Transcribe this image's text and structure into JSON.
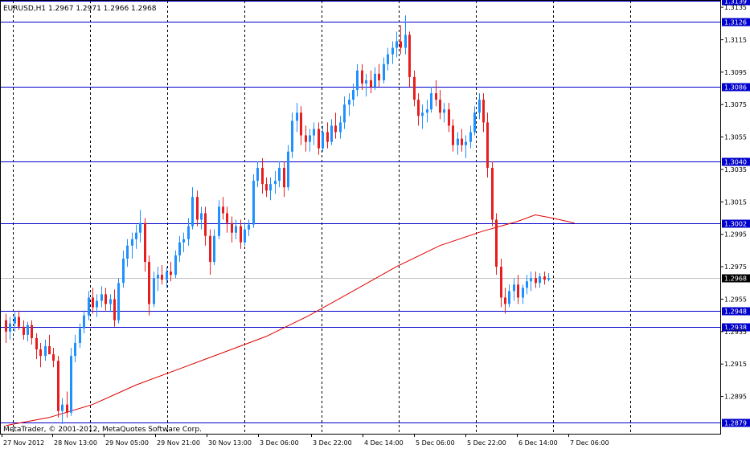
{
  "header": {
    "symbol_text": "EURUSD,H1  1.2967 1.2971 1.2966 1.2968"
  },
  "footer": {
    "copyright": "MetaTrader, © 2001-2012, MetaQuotes Software Corp."
  },
  "colors": {
    "background": "#ffffff",
    "frame": "#000000",
    "grid": "#000000",
    "bull": "#1e90ff",
    "bear": "#e81d1d",
    "moving_average": "#e00000",
    "levels": "#0000cc",
    "current_price_line": "#c0c0c0",
    "current_price_tag": "#000000"
  },
  "chart_data": {
    "type": "candlestick",
    "ylim": [
      1.2872,
      1.3139
    ],
    "y_ticks": [
      "1.3135",
      "1.3115",
      "1.3095",
      "1.3075",
      "1.3055",
      "1.3035",
      "1.3015",
      "1.2995",
      "1.2975",
      "1.2955",
      "1.2935",
      "1.2915",
      "1.2895"
    ],
    "x_ticks": [
      "27 Nov 2012",
      "28 Nov 13:00",
      "29 Nov 05:00",
      "29 Nov 21:00",
      "30 Nov 13:00",
      "3 Dec 06:00",
      "3 Dec 22:00",
      "4 Dec 14:00",
      "5 Dec 06:00",
      "5 Dec 22:00",
      "6 Dec 14:00",
      "7 Dec 06:00"
    ],
    "levels": [
      "1.3139",
      "1.3126",
      "1.3086",
      "1.3040",
      "1.3002",
      "1.2948",
      "1.2938",
      "1.2879"
    ],
    "current_price": "1.2968",
    "candles": [
      [
        1.2942,
        1.2946,
        1.2928,
        1.2935
      ],
      [
        1.2935,
        1.2944,
        1.293,
        1.294
      ],
      [
        1.294,
        1.2947,
        1.2935,
        1.2944
      ],
      [
        1.2944,
        1.2948,
        1.2936,
        1.2938
      ],
      [
        1.2938,
        1.2942,
        1.293,
        1.2933
      ],
      [
        1.2933,
        1.2941,
        1.2929,
        1.2939
      ],
      [
        1.2939,
        1.2942,
        1.2927,
        1.2931
      ],
      [
        1.2931,
        1.2934,
        1.2918,
        1.2924
      ],
      [
        1.2924,
        1.2928,
        1.2913,
        1.292
      ],
      [
        1.292,
        1.293,
        1.2917,
        1.2926
      ],
      [
        1.2926,
        1.2933,
        1.2922,
        1.2921
      ],
      [
        1.2921,
        1.2925,
        1.2913,
        1.2917
      ],
      [
        1.2917,
        1.292,
        1.2882,
        1.2886
      ],
      [
        1.2886,
        1.2894,
        1.2878,
        1.289
      ],
      [
        1.289,
        1.2898,
        1.2882,
        1.2885
      ],
      [
        1.2885,
        1.2925,
        1.2883,
        1.292
      ],
      [
        1.292,
        1.2933,
        1.2916,
        1.2928
      ],
      [
        1.2928,
        1.294,
        1.2925,
        1.2937
      ],
      [
        1.2937,
        1.2948,
        1.2934,
        1.2945
      ],
      [
        1.2945,
        1.296,
        1.2942,
        1.2956
      ],
      [
        1.2956,
        1.2962,
        1.2946,
        1.295
      ],
      [
        1.295,
        1.2958,
        1.2944,
        1.2954
      ],
      [
        1.2954,
        1.2963,
        1.295,
        1.2958
      ],
      [
        1.2958,
        1.2962,
        1.2948,
        1.2952
      ],
      [
        1.2952,
        1.2958,
        1.2947,
        1.2955
      ],
      [
        1.2955,
        1.2961,
        1.2938,
        1.2942
      ],
      [
        1.2942,
        1.2968,
        1.294,
        1.2965
      ],
      [
        1.2965,
        1.2985,
        1.2962,
        1.298
      ],
      [
        1.298,
        1.2992,
        1.2975,
        1.2988
      ],
      [
        1.2988,
        1.2996,
        1.298,
        1.2992
      ],
      [
        1.2992,
        1.3001,
        1.2986,
        1.2996
      ],
      [
        1.2996,
        1.301,
        1.299,
        1.3002
      ],
      [
        1.3002,
        1.3005,
        1.2972,
        1.2978
      ],
      [
        1.2978,
        1.2982,
        1.2945,
        1.2952
      ],
      [
        1.2952,
        1.2972,
        1.295,
        1.2968
      ],
      [
        1.2968,
        1.2975,
        1.296,
        1.297
      ],
      [
        1.297,
        1.2976,
        1.2964,
        1.2967
      ],
      [
        1.2967,
        1.2975,
        1.2962,
        1.2972
      ],
      [
        1.2972,
        1.2978,
        1.2966,
        1.297
      ],
      [
        1.297,
        1.2985,
        1.2968,
        1.2982
      ],
      [
        1.2982,
        1.2994,
        1.2978,
        1.299
      ],
      [
        1.299,
        1.2996,
        1.2984,
        1.2992
      ],
      [
        1.2992,
        1.3005,
        1.2988,
        1.3
      ],
      [
        1.3,
        1.3024,
        1.2998,
        1.3018
      ],
      [
        1.3018,
        1.3022,
        1.3,
        1.3004
      ],
      [
        1.3004,
        1.3012,
        1.2998,
        1.3008
      ],
      [
        1.3008,
        1.3012,
        1.2988,
        1.2994
      ],
      [
        1.2994,
        1.2998,
        1.297,
        1.2978
      ],
      [
        1.2978,
        1.2998,
        1.2976,
        1.2994
      ],
      [
        1.2994,
        1.3016,
        1.2992,
        1.3012
      ],
      [
        1.3012,
        1.3018,
        1.3004,
        1.3008
      ],
      [
        1.3008,
        1.3012,
        1.2996,
        1.3002
      ],
      [
        1.3002,
        1.3006,
        1.299,
        1.2996
      ],
      [
        1.2996,
        1.3004,
        1.2992,
        1.3
      ],
      [
        1.3,
        1.3004,
        1.2986,
        1.299
      ],
      [
        1.299,
        1.3002,
        1.2988,
        1.2998
      ],
      [
        1.2998,
        1.3004,
        1.2994,
        1.3001
      ],
      [
        1.3001,
        1.3032,
        1.2999,
        1.3028
      ],
      [
        1.3028,
        1.304,
        1.3024,
        1.3036
      ],
      [
        1.3036,
        1.3042,
        1.302,
        1.3026
      ],
      [
        1.3026,
        1.303,
        1.3018,
        1.3022
      ],
      [
        1.3022,
        1.303,
        1.3016,
        1.3026
      ],
      [
        1.3026,
        1.3034,
        1.302,
        1.3028
      ],
      [
        1.3028,
        1.304,
        1.3024,
        1.3036
      ],
      [
        1.3036,
        1.304,
        1.3018,
        1.3024
      ],
      [
        1.3024,
        1.305,
        1.3022,
        1.3046
      ],
      [
        1.3046,
        1.307,
        1.3042,
        1.3065
      ],
      [
        1.3065,
        1.3076,
        1.3058,
        1.307
      ],
      [
        1.307,
        1.3074,
        1.305,
        1.3056
      ],
      [
        1.3056,
        1.3062,
        1.3046,
        1.3052
      ],
      [
        1.3052,
        1.306,
        1.3046,
        1.3056
      ],
      [
        1.3056,
        1.3064,
        1.305,
        1.306
      ],
      [
        1.306,
        1.3064,
        1.3044,
        1.3048
      ],
      [
        1.3048,
        1.3062,
        1.3046,
        1.3058
      ],
      [
        1.3058,
        1.3064,
        1.3048,
        1.3052
      ],
      [
        1.3052,
        1.3066,
        1.305,
        1.3062
      ],
      [
        1.3062,
        1.307,
        1.3054,
        1.3058
      ],
      [
        1.3058,
        1.3068,
        1.3054,
        1.3064
      ],
      [
        1.3064,
        1.308,
        1.306,
        1.3075
      ],
      [
        1.3075,
        1.3082,
        1.3068,
        1.3078
      ],
      [
        1.3078,
        1.3088,
        1.3074,
        1.3084
      ],
      [
        1.3084,
        1.31,
        1.308,
        1.3096
      ],
      [
        1.3096,
        1.31,
        1.3084,
        1.3088
      ],
      [
        1.3088,
        1.3094,
        1.308,
        1.309
      ],
      [
        1.309,
        1.3096,
        1.3082,
        1.3086
      ],
      [
        1.3086,
        1.3098,
        1.3084,
        1.3094
      ],
      [
        1.3094,
        1.31,
        1.3086,
        1.309
      ],
      [
        1.309,
        1.3104,
        1.3088,
        1.31
      ],
      [
        1.31,
        1.311,
        1.3096,
        1.3106
      ],
      [
        1.3106,
        1.3114,
        1.31,
        1.311
      ],
      [
        1.311,
        1.312,
        1.3104,
        1.3114
      ],
      [
        1.3114,
        1.3124,
        1.3106,
        1.311
      ],
      [
        1.311,
        1.313,
        1.3106,
        1.3118
      ],
      [
        1.3118,
        1.312,
        1.3086,
        1.3092
      ],
      [
        1.3092,
        1.3096,
        1.3074,
        1.3078
      ],
      [
        1.3078,
        1.3082,
        1.3062,
        1.3068
      ],
      [
        1.3068,
        1.3075,
        1.306,
        1.307
      ],
      [
        1.307,
        1.3078,
        1.3064,
        1.3072
      ],
      [
        1.3072,
        1.3086,
        1.307,
        1.3082
      ],
      [
        1.3082,
        1.309,
        1.3074,
        1.3078
      ],
      [
        1.3078,
        1.3084,
        1.3066,
        1.307
      ],
      [
        1.307,
        1.3076,
        1.3064,
        1.3072
      ],
      [
        1.3072,
        1.3076,
        1.3058,
        1.3062
      ],
      [
        1.3062,
        1.3066,
        1.3046,
        1.305
      ],
      [
        1.305,
        1.3058,
        1.3044,
        1.3054
      ],
      [
        1.3054,
        1.306,
        1.3046,
        1.305
      ],
      [
        1.305,
        1.3056,
        1.3042,
        1.3052
      ],
      [
        1.3052,
        1.3062,
        1.3048,
        1.3058
      ],
      [
        1.3058,
        1.3074,
        1.3056,
        1.307
      ],
      [
        1.307,
        1.3082,
        1.3066,
        1.3078
      ],
      [
        1.3078,
        1.3082,
        1.3058,
        1.3064
      ],
      [
        1.3064,
        1.307,
        1.303,
        1.3036
      ],
      [
        1.3036,
        1.304,
        1.3,
        1.3004
      ],
      [
        1.3004,
        1.3008,
        1.297,
        1.2975
      ],
      [
        1.2975,
        1.298,
        1.295,
        1.2956
      ],
      [
        1.2956,
        1.2962,
        1.2946,
        1.2952
      ],
      [
        1.2952,
        1.2964,
        1.295,
        1.296
      ],
      [
        1.296,
        1.2968,
        1.2954,
        1.2964
      ],
      [
        1.2964,
        1.297,
        1.2952,
        1.2956
      ],
      [
        1.2956,
        1.2964,
        1.2952,
        1.2962
      ],
      [
        1.2962,
        1.297,
        1.2958,
        1.2966
      ],
      [
        1.2966,
        1.2972,
        1.296,
        1.2968
      ],
      [
        1.2968,
        1.2972,
        1.2962,
        1.2965
      ],
      [
        1.2965,
        1.2971,
        1.2962,
        1.2969
      ],
      [
        1.2969,
        1.2972,
        1.2964,
        1.2967
      ],
      [
        1.2967,
        1.2971,
        1.2966,
        1.2968
      ]
    ],
    "moving_average": [
      [
        0,
        1.2877
      ],
      [
        10,
        1.2882
      ],
      [
        20,
        1.289
      ],
      [
        30,
        1.2902
      ],
      [
        40,
        1.2912
      ],
      [
        50,
        1.2922
      ],
      [
        60,
        1.2932
      ],
      [
        70,
        1.2945
      ],
      [
        80,
        1.296
      ],
      [
        90,
        1.2975
      ],
      [
        100,
        1.2988
      ],
      [
        110,
        1.2997
      ],
      [
        118,
        1.3003
      ],
      [
        122,
        1.3007
      ],
      [
        126,
        1.3005
      ],
      [
        131,
        1.3002
      ]
    ]
  }
}
